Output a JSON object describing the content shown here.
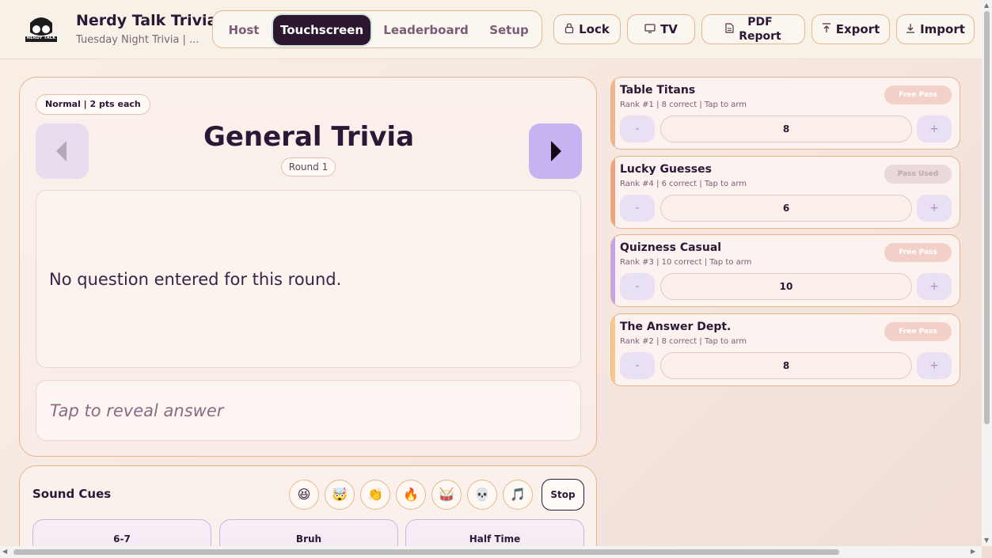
{
  "header": {
    "logo_text": "NERDY TALK",
    "title": "Nerdy Talk Trivia",
    "subtitle": "Tuesday Night Trivia | ...",
    "tabs": [
      {
        "label": "Host"
      },
      {
        "label": "Touchscreen",
        "active": true
      },
      {
        "label": "Leaderboard"
      },
      {
        "label": "Setup"
      }
    ],
    "actions": {
      "lock": {
        "label": "Lock",
        "icon": "lock-icon"
      },
      "tv": {
        "label": "TV",
        "icon": "monitor-icon"
      },
      "pdf_line1": "PDF",
      "pdf_line2": "Report",
      "export": {
        "label": "Export",
        "icon": "upload-icon"
      },
      "import": {
        "label": "Import",
        "icon": "download-icon"
      }
    }
  },
  "round": {
    "mode": "Normal | 2 pts each",
    "title": "General Trivia",
    "number": "Round 1",
    "question": "No question entered for this round.",
    "answer_prompt": "Tap to reveal answer"
  },
  "sound": {
    "title": "Sound Cues",
    "emojis": [
      "😆",
      "🤯",
      "👏",
      "🔥",
      "🥁",
      "💀",
      "🎵"
    ],
    "stop_label": "Stop",
    "cues": [
      "6-7",
      "Bruh",
      "Half Time"
    ]
  },
  "teams": [
    {
      "name": "Table Titans",
      "meta": "Rank #1 | 8 correct | Tap to arm",
      "pass": "Free Pass",
      "pass_used": false,
      "score": "8",
      "stripe": "#f0b58d"
    },
    {
      "name": "Lucky Guesses",
      "meta": "Rank #4 | 6 correct | Tap to arm",
      "pass": "Pass Used",
      "pass_used": true,
      "score": "6",
      "stripe": "#e9a57c"
    },
    {
      "name": "Quizness Casual",
      "meta": "Rank #3 | 10 correct | Tap to arm",
      "pass": "Free Pass",
      "pass_used": false,
      "score": "10",
      "stripe": "#c0a5ee"
    },
    {
      "name": "The Answer Dept.",
      "meta": "Rank #2 | 8 correct | Tap to arm",
      "pass": "Free Pass",
      "pass_used": false,
      "score": "8",
      "stripe": "#f5c98a"
    }
  ],
  "controls": {
    "minus": "-",
    "plus": "+"
  }
}
